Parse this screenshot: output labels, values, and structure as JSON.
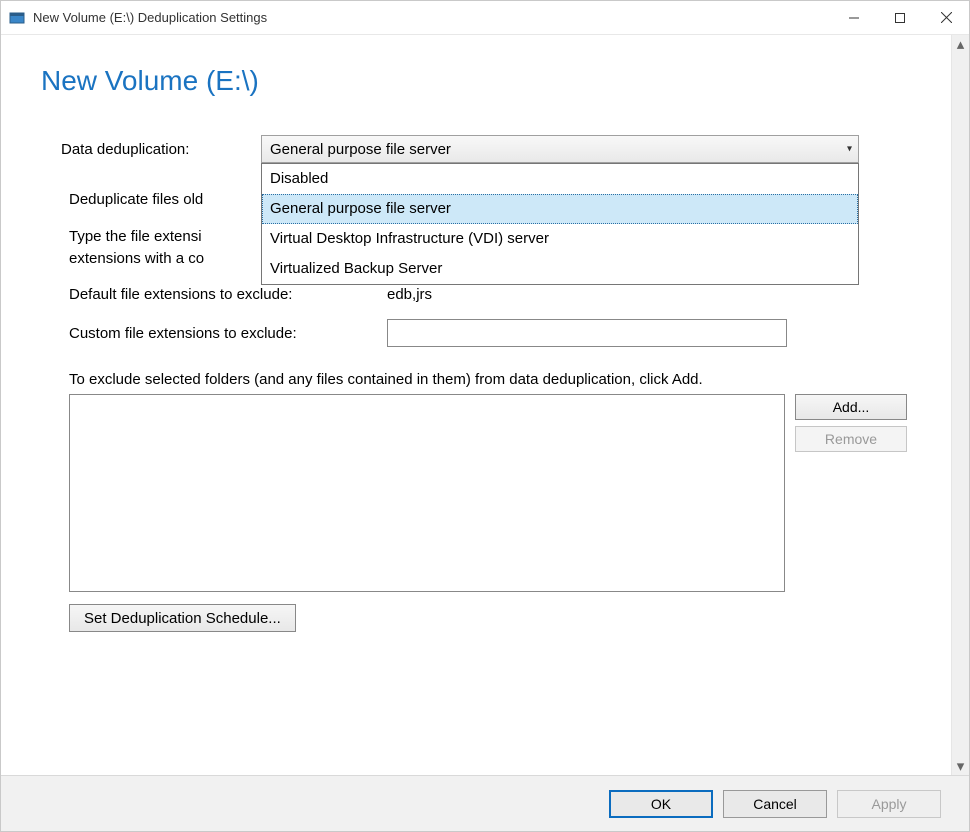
{
  "window": {
    "title": "New Volume (E:\\) Deduplication Settings"
  },
  "page": {
    "heading": "New Volume (E:\\)"
  },
  "dedup": {
    "label": "Data deduplication:",
    "selected": "General purpose file server",
    "options": [
      "Disabled",
      "General purpose file server",
      "Virtual Desktop Infrastructure (VDI) server",
      "Virtualized Backup Server"
    ],
    "selected_index": 1
  },
  "age": {
    "label_prefix": "Deduplicate files old"
  },
  "extensions": {
    "help_prefix_line1": "Type the file extensi",
    "help_prefix_line2": "extensions with a co",
    "default_label": "Default file extensions to exclude:",
    "default_value": "edb,jrs",
    "custom_label": "Custom file extensions to exclude:",
    "custom_value": ""
  },
  "exclude": {
    "instruction": "To exclude selected folders (and any files contained in them) from data deduplication, click Add.",
    "add_label": "Add...",
    "remove_label": "Remove"
  },
  "schedule": {
    "button_label": "Set Deduplication Schedule..."
  },
  "footer": {
    "ok": "OK",
    "cancel": "Cancel",
    "apply": "Apply"
  }
}
